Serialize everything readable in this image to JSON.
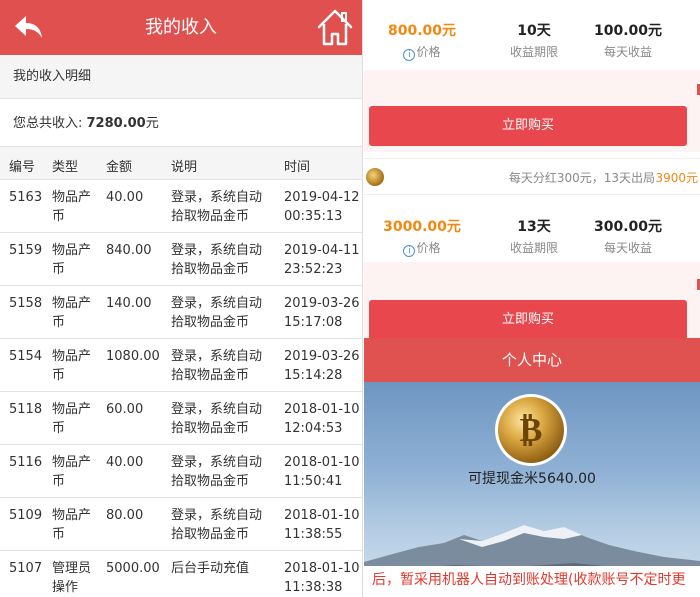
{
  "header": {
    "title": "我的收入"
  },
  "income": {
    "section_title": "我的收入明细",
    "total_label": "您总共收入: ",
    "total_value": "7280.00",
    "total_unit": "元",
    "columns": [
      "编号",
      "类型",
      "金额",
      "说明",
      "时间"
    ],
    "rows": [
      {
        "id": "5163",
        "type": "物品产币",
        "amount": "40.00",
        "desc": "登录，系统自动拾取物品金币",
        "time": "2019-04-12 00:35:13"
      },
      {
        "id": "5159",
        "type": "物品产币",
        "amount": "840.00",
        "desc": "登录，系统自动拾取物品金币",
        "time": "2019-04-11 23:52:23"
      },
      {
        "id": "5158",
        "type": "物品产币",
        "amount": "140.00",
        "desc": "登录，系统自动拾取物品金币",
        "time": "2019-03-26 15:17:08"
      },
      {
        "id": "5154",
        "type": "物品产币",
        "amount": "1080.00",
        "desc": "登录，系统自动拾取物品金币",
        "time": "2019-03-26 15:14:28"
      },
      {
        "id": "5118",
        "type": "物品产币",
        "amount": "60.00",
        "desc": "登录，系统自动拾取物品金币",
        "time": "2018-01-10 12:04:53"
      },
      {
        "id": "5116",
        "type": "物品产币",
        "amount": "40.00",
        "desc": "登录，系统自动拾取物品金币",
        "time": "2018-01-10 11:50:41"
      },
      {
        "id": "5109",
        "type": "物品产币",
        "amount": "80.00",
        "desc": "登录，系统自动拾取物品金币",
        "time": "2018-01-10 11:38:55"
      },
      {
        "id": "5107",
        "type": "管理员操作",
        "amount": "5000.00",
        "desc": "后台手动充值",
        "time": "2018-01-10 11:38:38"
      }
    ]
  },
  "products": [
    {
      "price": "800.00元",
      "price_label": "价格",
      "period": "10天",
      "period_label": "收益期限",
      "daily": "100.00元",
      "daily_label": "每天收益",
      "buy_label": "立即购买"
    },
    {
      "price": "3000.00元",
      "price_label": "价格",
      "period": "13天",
      "period_label": "收益期限",
      "daily": "300.00元",
      "daily_label": "每天收益",
      "buy_label": "立即购买"
    }
  ],
  "product_row": {
    "desc": "每天分红300元，13天出局",
    "price": "3900元"
  },
  "personal": {
    "title": "个人中心",
    "withdrawable": "可提现金米5640.00",
    "notice": "后，暂采用机器人自动到账处理(收款账号不定时更"
  },
  "colors": {
    "header_red": "#e0504e",
    "button_red": "#e8484d",
    "price_orange": "#f3870f",
    "notice_red": "#e03a2e"
  },
  "icons": [
    "back-arrow-icon",
    "home-icon",
    "info-icon",
    "coin-icon",
    "bitcoin-avatar"
  ]
}
